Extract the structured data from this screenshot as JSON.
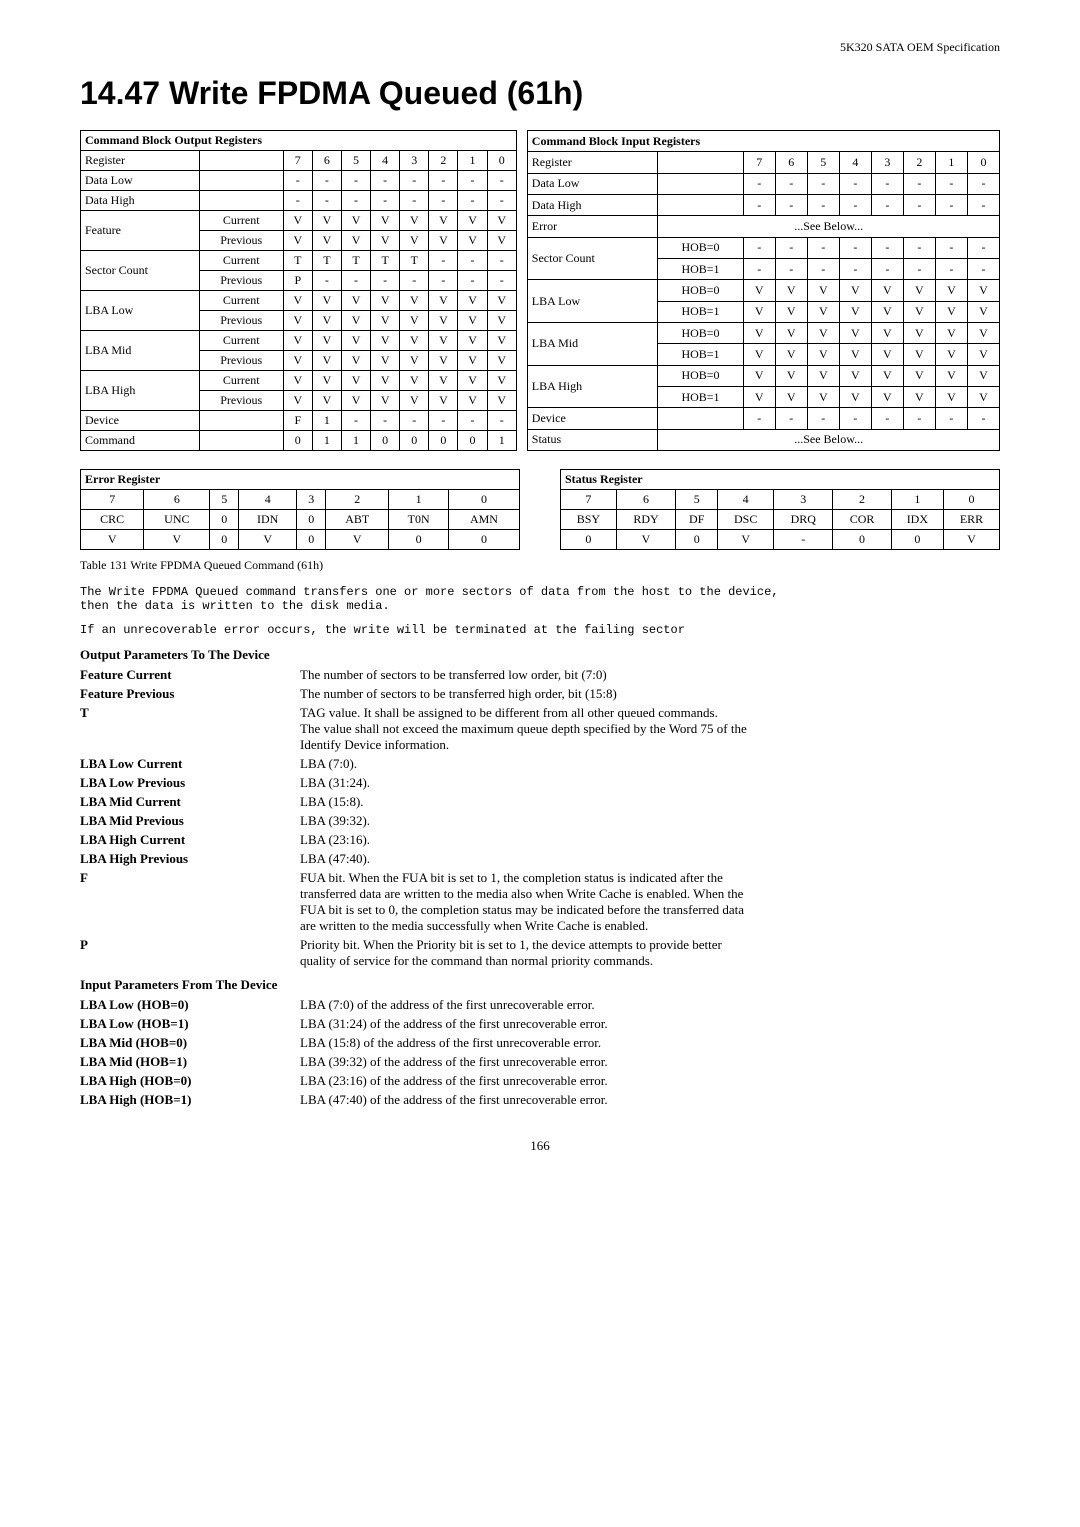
{
  "header": {
    "title": "5K320 SATA OEM Specification"
  },
  "page_title": "14.47   Write FPDMA Queued (61h)",
  "output_table": {
    "header": "Command Block Output Registers",
    "columns": [
      "Register",
      "",
      "7",
      "6",
      "5",
      "4",
      "3",
      "2",
      "1",
      "0"
    ],
    "rows": [
      [
        "Register",
        "",
        "7",
        "6",
        "5",
        "4",
        "3",
        "2",
        "1",
        "0"
      ],
      [
        "Data Low",
        "",
        "-",
        "-",
        "-",
        "-",
        "-",
        "-",
        "-",
        "-"
      ],
      [
        "Data High",
        "",
        "-",
        "-",
        "-",
        "-",
        "-",
        "-",
        "-",
        "-"
      ],
      [
        "Feature",
        "Current",
        "V",
        "V",
        "V",
        "V",
        "V",
        "V",
        "V",
        "V"
      ],
      [
        "",
        "Previous",
        "V",
        "V",
        "V",
        "V",
        "V",
        "V",
        "V",
        "V"
      ],
      [
        "Sector Count",
        "Current",
        "T",
        "T",
        "T",
        "T",
        "T",
        "-",
        "-",
        "-"
      ],
      [
        "",
        "Previous",
        "P",
        "-",
        "-",
        "-",
        "-",
        "-",
        "-",
        "-"
      ],
      [
        "LBA Low",
        "Current",
        "V",
        "V",
        "V",
        "V",
        "V",
        "V",
        "V",
        "V"
      ],
      [
        "",
        "Previous",
        "V",
        "V",
        "V",
        "V",
        "V",
        "V",
        "V",
        "V"
      ],
      [
        "LBA Mid",
        "Current",
        "V",
        "V",
        "V",
        "V",
        "V",
        "V",
        "V",
        "V"
      ],
      [
        "",
        "Previous",
        "V",
        "V",
        "V",
        "V",
        "V",
        "V",
        "V",
        "V"
      ],
      [
        "LBA High",
        "Current",
        "V",
        "V",
        "V",
        "V",
        "V",
        "V",
        "V",
        "V"
      ],
      [
        "",
        "Previous",
        "V",
        "V",
        "V",
        "V",
        "V",
        "V",
        "V",
        "V"
      ],
      [
        "Device",
        "",
        "F",
        "1",
        "-",
        "-",
        "-",
        "-",
        "-",
        "-"
      ],
      [
        "Command",
        "",
        "0",
        "1",
        "1",
        "0",
        "0",
        "0",
        "0",
        "1"
      ]
    ]
  },
  "input_table": {
    "header": "Command Block Input Registers",
    "columns": [
      "Register",
      "",
      "7",
      "6",
      "5",
      "4",
      "3",
      "2",
      "1",
      "0"
    ],
    "rows": [
      [
        "Register",
        "",
        "7",
        "6",
        "5",
        "4",
        "3",
        "2",
        "1",
        "0"
      ],
      [
        "Data Low",
        "",
        "-",
        "-",
        "-",
        "-",
        "-",
        "-",
        "-",
        "-"
      ],
      [
        "Data High",
        "",
        "-",
        "-",
        "-",
        "-",
        "-",
        "-",
        "-",
        "-"
      ],
      [
        "Error",
        "",
        "...See Below..."
      ],
      [
        "Sector Count",
        "HOB=0",
        "-",
        "-",
        "-",
        "-",
        "-",
        "-",
        "-",
        "-"
      ],
      [
        "",
        "HOB=1",
        "-",
        "-",
        "-",
        "-",
        "-",
        "-",
        "-",
        "-"
      ],
      [
        "LBA Low",
        "HOB=0",
        "V",
        "V",
        "V",
        "V",
        "V",
        "V",
        "V",
        "V"
      ],
      [
        "",
        "HOB=1",
        "V",
        "V",
        "V",
        "V",
        "V",
        "V",
        "V",
        "V"
      ],
      [
        "LBA Mid",
        "HOB=0",
        "V",
        "V",
        "V",
        "V",
        "V",
        "V",
        "V",
        "V"
      ],
      [
        "",
        "HOB=1",
        "V",
        "V",
        "V",
        "V",
        "V",
        "V",
        "V",
        "V"
      ],
      [
        "LBA High",
        "HOB=0",
        "V",
        "V",
        "V",
        "V",
        "V",
        "V",
        "V",
        "V"
      ],
      [
        "",
        "HOB=1",
        "V",
        "V",
        "V",
        "V",
        "V",
        "V",
        "V",
        "V"
      ],
      [
        "Device",
        "",
        "-",
        "-",
        "-",
        "-",
        "-",
        "-",
        "-",
        "-"
      ],
      [
        "Status",
        "",
        "...See Below..."
      ]
    ]
  },
  "error_register": {
    "header": "Error Register",
    "row1": [
      "7",
      "6",
      "5",
      "4",
      "3",
      "2",
      "1",
      "0"
    ],
    "row2": [
      "CRC",
      "UNC",
      "0",
      "IDN",
      "0",
      "ABT",
      "T0N",
      "AMN"
    ],
    "row3": [
      "V",
      "V",
      "0",
      "V",
      "0",
      "V",
      "0",
      "0"
    ]
  },
  "status_register": {
    "header": "Status Register",
    "row1": [
      "7",
      "6",
      "5",
      "4",
      "3",
      "2",
      "1",
      "0"
    ],
    "row2": [
      "BSY",
      "RDY",
      "DF",
      "DSC",
      "DRQ",
      "COR",
      "IDX",
      "ERR"
    ],
    "row3": [
      "0",
      "V",
      "0",
      "V",
      "-",
      "0",
      "0",
      "V"
    ]
  },
  "table_caption": "Table 131 Write FPDMA Queued Command (61h)",
  "body_text1": "The Write FPDMA Queued command transfers one or more sectors of data from the host to the device,\nthen the data is written to the disk media.",
  "body_text2": "If an unrecoverable error occurs, the write will be terminated at the failing sector",
  "output_params_title": "Output Parameters To The Device",
  "output_params": [
    {
      "label": "Feature Current",
      "value": "The number of sectors to be transferred low order, bit (7:0)"
    },
    {
      "label": "Feature Previous",
      "value": "The number of sectors to be transferred high order, bit (15:8)"
    },
    {
      "label": "T",
      "value": "TAG value.   It shall be assigned to be different from all other queued commands.\nThe value shall not exceed the maximum queue depth specified by the Word 75 of the\nIdentify Device information."
    },
    {
      "label": "LBA Low Current",
      "value": "LBA (7:0)."
    },
    {
      "label": "LBA Low Previous",
      "value": "LBA (31:24)."
    },
    {
      "label": "LBA Mid Current",
      "value": "LBA (15:8)."
    },
    {
      "label": "LBA Mid Previous",
      "value": "LBA (39:32)."
    },
    {
      "label": "LBA High Current",
      "value": "LBA (23:16)."
    },
    {
      "label": "LBA High Previous",
      "value": "LBA (47:40)."
    },
    {
      "label": "F",
      "value": "FUA bit.   When the FUA bit is set to 1, the completion status is indicated after the\ntransferred data are written to the media also when Write Cache is enabled.   When the\nFUA bit is set to 0, the completion status may be indicated before the transferred data\nare written to the media successfully when Write Cache is enabled."
    },
    {
      "label": "P",
      "value": "Priority bit.   When the Priority bit is set to 1, the device attempts to provide better\nquality of service for the command than normal priority commands."
    }
  ],
  "input_params_title": "Input Parameters From The Device",
  "input_params": [
    {
      "label": "LBA Low (HOB=0)",
      "value": "LBA (7:0) of the address of the first unrecoverable error."
    },
    {
      "label": "LBA Low (HOB=1)",
      "value": "LBA (31:24) of the address of the first unrecoverable error."
    },
    {
      "label": "LBA Mid (HOB=0)",
      "value": "LBA (15:8) of the address of the first unrecoverable error."
    },
    {
      "label": "LBA Mid (HOB=1)",
      "value": "LBA (39:32) of the address of the first unrecoverable error."
    },
    {
      "label": "LBA High (HOB=0)",
      "value": "LBA (23:16) of the address of the first unrecoverable error."
    },
    {
      "label": "LBA High (HOB=1)",
      "value": "LBA (47:40) of the address of the first unrecoverable error."
    }
  ],
  "page_number": "166"
}
